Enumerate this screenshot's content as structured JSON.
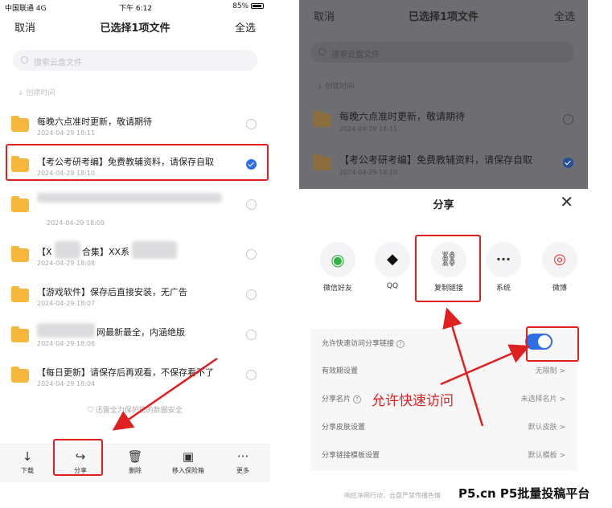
{
  "status": {
    "carrier": "中国联通 4G",
    "time": "下午 6:12",
    "battery": "85%"
  },
  "header": {
    "cancel": "取消",
    "title": "已选择1项文件",
    "select_all": "全选"
  },
  "search": {
    "placeholder": "搜索云盘文件"
  },
  "sort": {
    "label": "创建时间"
  },
  "files": [
    {
      "name": "每晚六点准时更新，敬请期待",
      "date": "2024-04-29 18:11",
      "checked": false
    },
    {
      "name": "【考公考研考编】免费教辅资料，请保存自取",
      "date": "2024-04-29 18:10",
      "checked": true
    },
    {
      "name": "",
      "date": "2024-04-29 18:09",
      "checked": false
    },
    {
      "name": "【X",
      "name_tail": "合集】XX系",
      "date": "2024-04-29 18:08",
      "checked": false
    },
    {
      "name": "【游戏软件】保存后直接安装，无广告",
      "date": "2024-04-29 18:07",
      "checked": false
    },
    {
      "name": "网最新最全，内涵绝版",
      "date": "2024-04-29 18:06",
      "checked": false
    },
    {
      "name": "【每日更新】请保存后再观看，不保存看不了",
      "date": "2024-04-29 18:04",
      "checked": false
    }
  ],
  "safety_note": "迅雷全力保护您的数据安全",
  "bottom_bar": [
    {
      "label": "下载",
      "icon": "download-icon"
    },
    {
      "label": "分享",
      "icon": "share-icon"
    },
    {
      "label": "删除",
      "icon": "trash-icon"
    },
    {
      "label": "移入保险箱",
      "icon": "safe-icon"
    },
    {
      "label": "更多",
      "icon": "more-icon"
    }
  ],
  "sheet": {
    "title": "分享",
    "targets": [
      {
        "label": "微信好友",
        "icon": "wechat-icon"
      },
      {
        "label": "QQ",
        "icon": "qq-icon"
      },
      {
        "label": "复制链接",
        "icon": "link-icon"
      },
      {
        "label": "系统",
        "icon": "more-icon"
      },
      {
        "label": "微博",
        "icon": "weibo-icon"
      }
    ],
    "settings": [
      {
        "label": "允许快速访问分享链接",
        "value": "",
        "toggle": true
      },
      {
        "label": "有效期设置",
        "value": "无限制 >"
      },
      {
        "label": "分享名片",
        "value": "未选择名片 >"
      },
      {
        "label": "分享皮肤设置",
        "value": "默认皮肤 >"
      },
      {
        "label": "分享链接模板设置",
        "value": "默认模板 >"
      }
    ],
    "footer": "响应净网行动，云盘严禁传播色情"
  },
  "annotation": "允许快速访问",
  "watermark": "P5.cn P5批量投稿平台",
  "colors": {
    "accent": "#2f6fe6",
    "folder": "#f6b73c",
    "highlight": "#e02020"
  }
}
